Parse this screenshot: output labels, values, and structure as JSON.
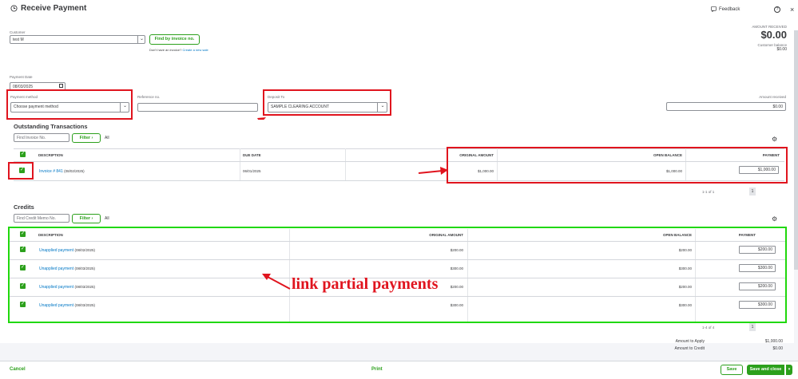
{
  "header": {
    "title": "Receive Payment",
    "feedback": "Feedback",
    "amount_received_label": "AMOUNT RECEIVED",
    "amount_received_value": "$0.00",
    "customer_balance_label": "Customer balance",
    "customer_balance_value": "$0.00"
  },
  "form": {
    "customer_label": "Customer",
    "customer_value": "test M",
    "find_by_invoice": "Find by invoice no.",
    "no_invoice_text": "Don't have an invoice?",
    "create_sale_link": "Create a new sale",
    "payment_date_label": "Payment Date",
    "payment_date_value": "08/03/2025",
    "payment_method_label": "Payment method",
    "payment_method_placeholder": "Choose payment method",
    "reference_label": "Reference no.",
    "deposit_to_label": "Deposit To",
    "deposit_to_value": "SAMPLE CLEARING ACCOUNT",
    "amount_received_label": "Amount received",
    "amount_received_value": "$0.00"
  },
  "outstanding": {
    "title": "Outstanding Transactions",
    "search_placeholder": "Find Invoice No.",
    "filter": "Filter",
    "all": "All",
    "columns": [
      "DESCRIPTION",
      "DUE DATE",
      "ORIGINAL AMOUNT",
      "OPEN BALANCE",
      "PAYMENT"
    ],
    "rows": [
      {
        "description": "Invoice # 841",
        "date": "(08/02/2025)",
        "due": "06/01/2025",
        "original": "$1,000.00",
        "open": "$1,000.00",
        "payment": "$1,000.00"
      }
    ],
    "pagination": "1-1 of 1",
    "page": "1"
  },
  "credits": {
    "title": "Credits",
    "search_placeholder": "Find Credit Memo No.",
    "filter": "Filter",
    "all": "All",
    "columns": [
      "DESCRIPTION",
      "ORIGINAL AMOUNT",
      "OPEN BALANCE",
      "PAYMENT"
    ],
    "rows": [
      {
        "description": "Unapplied payment",
        "date": "(08/02/2025)",
        "original": "$200.00",
        "open": "$200.00",
        "payment": "$200.00"
      },
      {
        "description": "Unapplied payment",
        "date": "(08/03/2025)",
        "original": "$300.00",
        "open": "$300.00",
        "payment": "$300.00"
      },
      {
        "description": "Unapplied payment",
        "date": "(08/03/2025)",
        "original": "$200.00",
        "open": "$200.00",
        "payment": "$200.00"
      },
      {
        "description": "Unapplied payment",
        "date": "(08/03/2025)",
        "original": "$300.00",
        "open": "$300.00",
        "payment": "$300.00"
      }
    ],
    "pagination": "1-4 of 4",
    "page": "1"
  },
  "totals": {
    "apply_label": "Amount to Apply",
    "apply_value": "$1,000.00",
    "credit_label": "Amount to Credit",
    "credit_value": "$0.00"
  },
  "annotation": {
    "text": "link partial payments",
    "color_red": "#e0141e",
    "color_green": "#20d80c"
  },
  "footer": {
    "cancel": "Cancel",
    "print": "Print",
    "save": "Save",
    "save_close": "Save and close"
  }
}
